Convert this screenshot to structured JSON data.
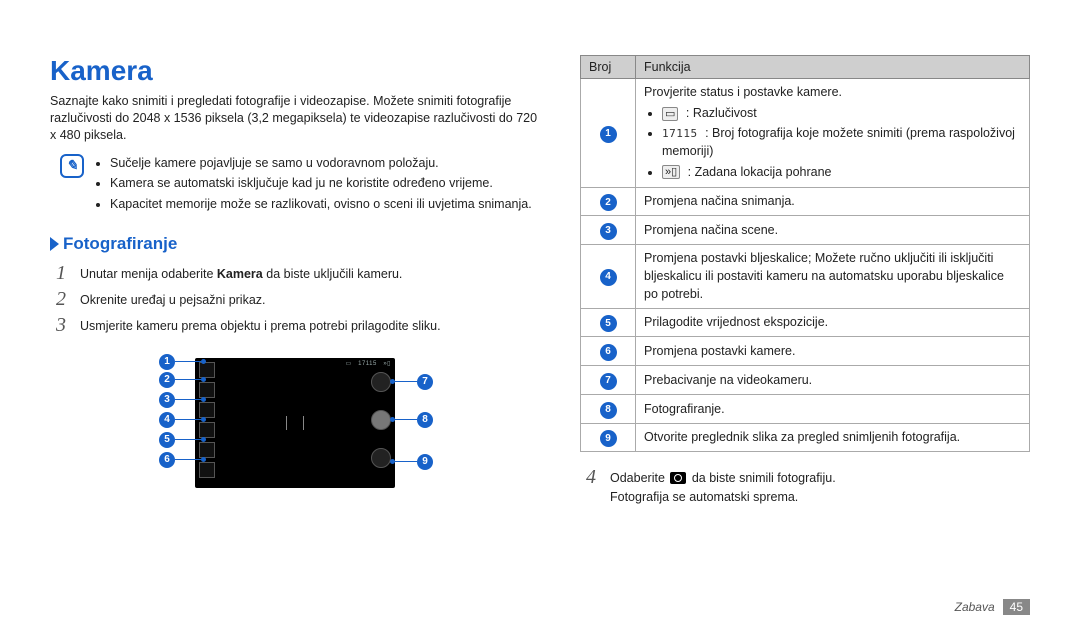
{
  "title": "Kamera",
  "intro": "Saznajte kako snimiti i pregledati fotografije i videozapise. Možete snimiti fotografije razlučivosti do 2048 x 1536 piksela (3,2 megapiksela) te videozapise razlučivosti do 720 x 480 piksela.",
  "notes": [
    "Sučelje kamere pojavljuje se samo u vodoravnom položaju.",
    "Kamera se automatski isključuje kad ju ne koristite određeno vrijeme.",
    "Kapacitet memorije može se razlikovati, ovisno o sceni ili uvjetima snimanja."
  ],
  "section_title": "Fotografiranje",
  "steps": [
    {
      "n": "1",
      "html": "Unutar menija odaberite <b>Kamera</b> da biste uključili kameru."
    },
    {
      "n": "2",
      "html": "Okrenite uređaj u pejsažni prikaz."
    },
    {
      "n": "3",
      "html": "Usmjerite kameru prema objektu i prema potrebi prilagodite sliku."
    }
  ],
  "step4": {
    "n": "4",
    "line1_pre": "Odaberite ",
    "line1_post": " da biste snimili fotografiju.",
    "line2": "Fotografija se automatski sprema."
  },
  "table": {
    "headers": {
      "num": "Broj",
      "func": "Funkcija"
    },
    "rows": [
      {
        "n": "1",
        "main": "Provjerite status i postavke kamere.",
        "subs": [
          {
            "icon": "res-icon",
            "text": " : Razlučivost"
          },
          {
            "icon": "count-icon",
            "text": " : Broj fotografija koje možete snimiti (prema raspoloživoj memoriji)"
          },
          {
            "icon": "storage-icon",
            "text": " : Zadana lokacija pohrane"
          }
        ]
      },
      {
        "n": "2",
        "main": "Promjena načina snimanja."
      },
      {
        "n": "3",
        "main": "Promjena načina scene."
      },
      {
        "n": "4",
        "main": "Promjena postavki bljeskalice; Možete ručno uključiti ili isključiti bljeskalicu ili postaviti kameru na automatsku uporabu bljeskalice po potrebi."
      },
      {
        "n": "5",
        "main": "Prilagodite vrijednost ekspozicije."
      },
      {
        "n": "6",
        "main": "Promjena postavki kamere."
      },
      {
        "n": "7",
        "main": "Prebacivanje na videokameru."
      },
      {
        "n": "8",
        "main": "Fotografiranje."
      },
      {
        "n": "9",
        "main": "Otvorite preglednik slika za pregled snimljenih fotografija."
      }
    ]
  },
  "counter_sample": "17115",
  "footer": {
    "section": "Zabava",
    "page": "45"
  }
}
